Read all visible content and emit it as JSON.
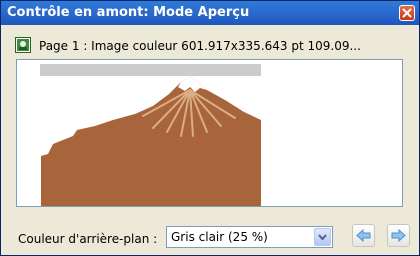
{
  "window": {
    "title": "Contrôle en amont: Mode Aperçu"
  },
  "info": {
    "page_label": "Page 1 : Image couleur 601.917x335.643 pt 109.09..."
  },
  "footer": {
    "background_label": "Couleur d'arrière-plan :",
    "background_value": "Gris clair (25 %)"
  },
  "colors": {
    "title_bar": "#2b6bd0",
    "mountain": "#a8643a",
    "snow_cap": "#ffffff",
    "gray_band": "#cccccc"
  },
  "icons": {
    "close": "close-icon",
    "page": "page-image-icon",
    "dropdown": "chevron-down-icon",
    "previous": "arrow-left-icon",
    "next": "arrow-right-icon"
  }
}
